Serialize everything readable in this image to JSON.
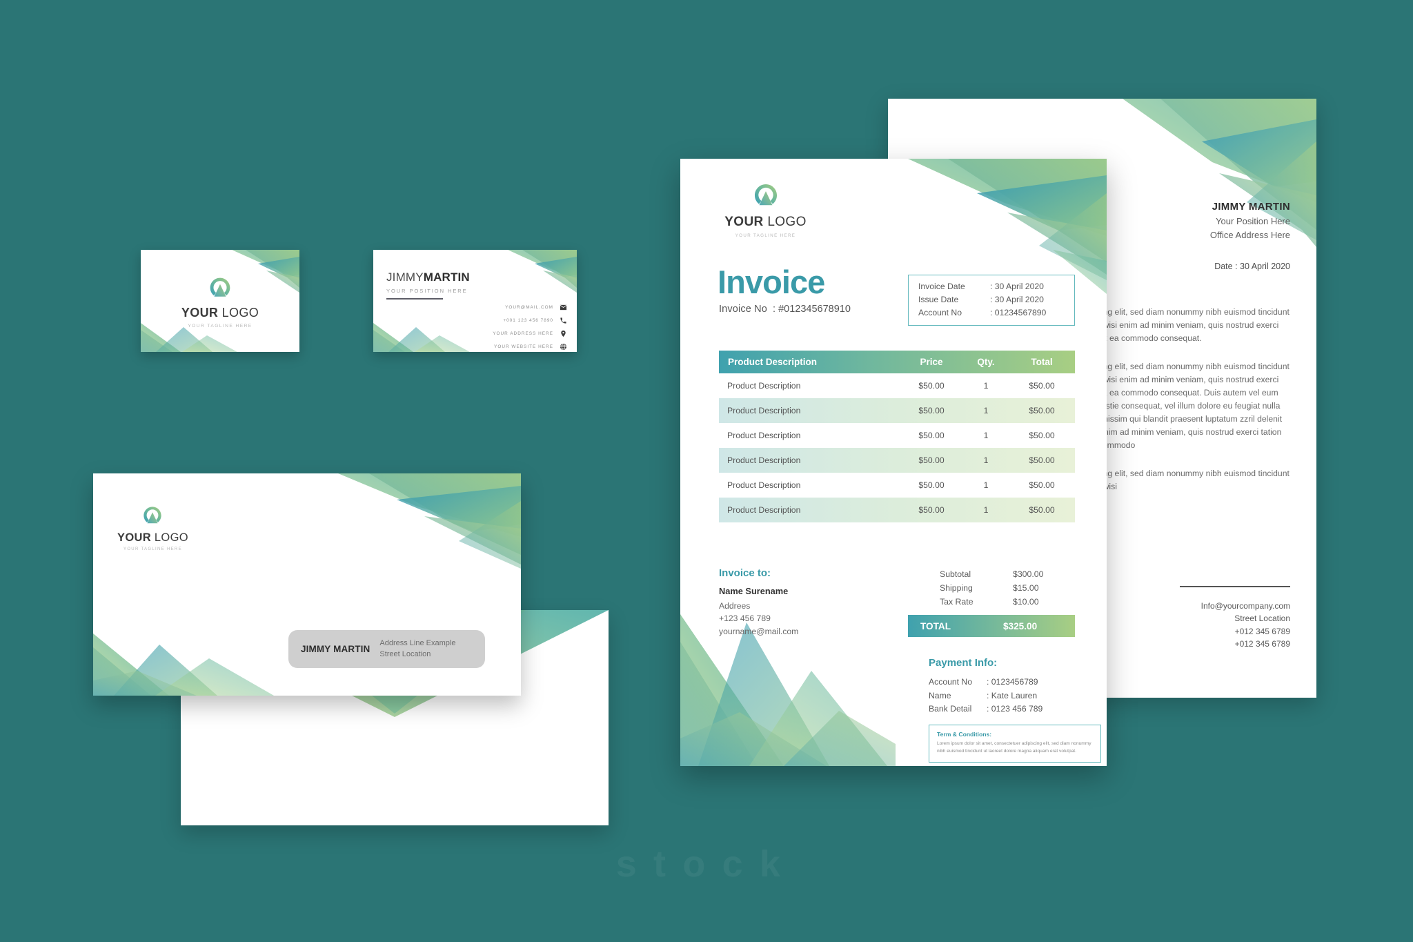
{
  "background_color": "#2b7575",
  "brand": {
    "accent_teal": "#3a9aa8",
    "accent_green": "#a8ce83",
    "logo_word_bold": "YOUR",
    "logo_word_light": "LOGO",
    "tagline": "YOUR TAGLINE HERE"
  },
  "business_card_front": {
    "logo_bold": "YOUR",
    "logo_light": "LOGO",
    "tagline": "YOUR TAGLINE HERE"
  },
  "business_card_back": {
    "name_light": "JIMMY",
    "name_bold": "MARTIN",
    "position": "YOUR POSITION HERE",
    "contacts": [
      {
        "icon": "mail-icon",
        "text": "YOUR@MAIL.COM"
      },
      {
        "icon": "phone-icon",
        "text": "+001 123 456 7890"
      },
      {
        "icon": "location-pin-icon",
        "text": "YOUR ADDRESS HERE"
      },
      {
        "icon": "globe-icon",
        "text": "YOUR WEBSITE HERE"
      }
    ]
  },
  "envelope": {
    "logo_bold": "YOUR",
    "logo_light": "LOGO",
    "tagline": "YOUR TAGLINE HERE",
    "address_name": "JIMMY MARTIN",
    "address_line_1": "Address Line Example",
    "address_line_2": "Street Location"
  },
  "letterhead": {
    "name": "JIMMY MARTIN",
    "position": "Your Position Here",
    "office": "Office Address Here",
    "date": "Date : 30 April 2020",
    "paragraphs": [
      "Lorem ipsum dolor sit amet, consectetuer adipiscing elit, sed diam nonummy nibh euismod tincidunt ut laoreet dolore magna aliquam erat volutpat. Ut wisi enim ad minim veniam, quis nostrud exerci tation ullamcorper suscipit lobortis nisl ut aliquip ex ea commodo consequat.",
      "Lorem ipsum dolor sit amet, consectetuer adipiscing elit, sed diam nonummy nibh euismod tincidunt ut laoreet dolore magna aliquam erat volutpat. Ut wisi enim ad minim veniam, quis nostrud exerci tation ullamcorper suscipit lobortis nisl ut aliquip ex ea commodo consequat. Duis autem vel eum iriure dolor in hendrerit in vulputate velit esse molestie consequat, vel illum dolore eu feugiat nulla facilisis at vero eros et accumsan et iusto odio dignissim qui blandit praesent luptatum zzril delenit augue duis dolore te feugait nulla facilisi. Ut wisi enim ad minim veniam, quis nostrud exerci tation ullamcorper suscipit lobortis nisl ut aliquip ex ea commodo",
      "Lorem ipsum dolor sit amet, consectetuer adipiscing elit, sed diam nonummy nibh euismod tincidunt ut laoreet dolore magna aliquam erat volutpat. Ut wisi"
    ],
    "footer": {
      "email": "Info@yourcompany.com",
      "street": "Street Location",
      "phone_1": "+012 345 6789",
      "phone_2": "+012 345 6789"
    }
  },
  "invoice": {
    "logo_bold": "YOUR",
    "logo_light": "LOGO",
    "tagline": "YOUR TAGLINE HERE",
    "title": "Invoice",
    "invoice_no_label": "Invoice No",
    "invoice_no_value": ": #012345678910",
    "meta": [
      {
        "key": "Invoice Date",
        "value": ": 30 April 2020"
      },
      {
        "key": "Issue Date",
        "value": ": 30 April 2020"
      },
      {
        "key": "Account No",
        "value": ": 01234567890"
      }
    ],
    "table": {
      "headers": [
        "Product Description",
        "Price",
        "Qty.",
        "Total"
      ],
      "rows": [
        [
          "Product Description",
          "$50.00",
          "1",
          "$50.00"
        ],
        [
          "Product Description",
          "$50.00",
          "1",
          "$50.00"
        ],
        [
          "Product Description",
          "$50.00",
          "1",
          "$50.00"
        ],
        [
          "Product Description",
          "$50.00",
          "1",
          "$50.00"
        ],
        [
          "Product Description",
          "$50.00",
          "1",
          "$50.00"
        ],
        [
          "Product Description",
          "$50.00",
          "1",
          "$50.00"
        ]
      ]
    },
    "invoice_to": {
      "heading": "Invoice to:",
      "name": "Name Surename",
      "address": "Addrees",
      "phone": "+123 456 789",
      "email": "yourname@mail.com"
    },
    "summary": {
      "rows": [
        {
          "key": "Subtotal",
          "value": "$300.00"
        },
        {
          "key": "Shipping",
          "value": "$15.00"
        },
        {
          "key": "Tax Rate",
          "value": "$10.00"
        }
      ],
      "total_label": "TOTAL",
      "total_value": "$325.00"
    },
    "payment_info": {
      "heading": "Payment Info:",
      "rows": [
        {
          "key": "Account No",
          "value": ": 0123456789"
        },
        {
          "key": "Name",
          "value": ": Kate Lauren"
        },
        {
          "key": "Bank Detail",
          "value": ": 0123 456 789"
        }
      ]
    },
    "terms": {
      "heading": "Term & Conditions:",
      "body": "Lorem ipsum dolor sit amet, consectetuer adipiscing elit, sed diam nonummy nibh euismod tincidunt ut laoreet dolore magna aliquam erat volutpat."
    }
  },
  "watermark": "stock"
}
